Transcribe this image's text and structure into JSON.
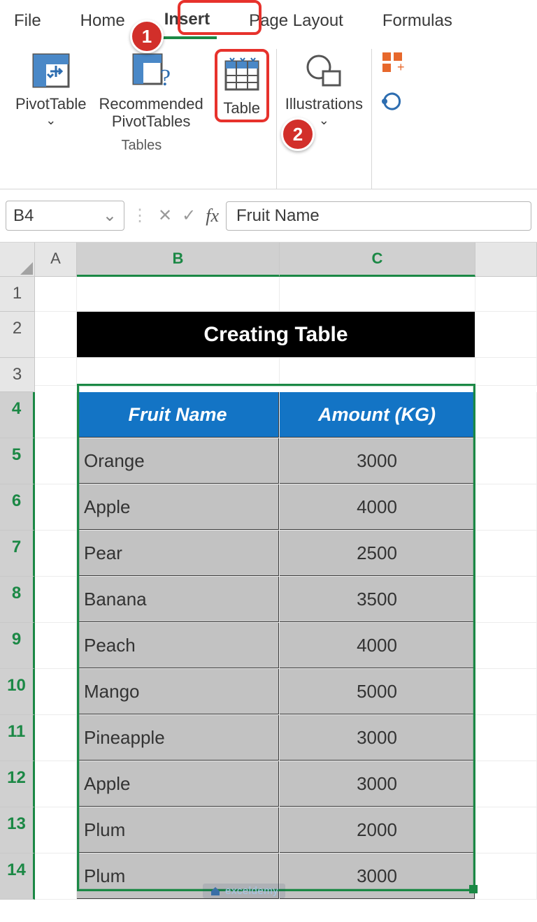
{
  "tabs": {
    "file": "File",
    "home": "Home",
    "insert": "Insert",
    "page_layout": "Page Layout",
    "formulas": "Formulas"
  },
  "ribbon": {
    "pivot_table": "PivotTable",
    "recommended_pivot": "Recommended\nPivotTables",
    "table": "Table",
    "illustrations": "Illustrations",
    "group_tables": "Tables"
  },
  "callouts": {
    "one": "1",
    "two": "2"
  },
  "namebox": {
    "ref": "B4"
  },
  "formula": {
    "value": "Fruit Name"
  },
  "columns": {
    "a": "A",
    "b": "B",
    "c": "C"
  },
  "rows": [
    "1",
    "2",
    "3",
    "4",
    "5",
    "6",
    "7",
    "8",
    "9",
    "10",
    "11",
    "12",
    "13",
    "14"
  ],
  "title": "Creating Table",
  "table_headers": {
    "fruit": "Fruit Name",
    "amount": "Amount (KG)"
  },
  "data": [
    {
      "fruit": "Orange",
      "amount": "3000"
    },
    {
      "fruit": "Apple",
      "amount": "4000"
    },
    {
      "fruit": "Pear",
      "amount": "2500"
    },
    {
      "fruit": "Banana",
      "amount": "3500"
    },
    {
      "fruit": "Peach",
      "amount": "4000"
    },
    {
      "fruit": "Mango",
      "amount": "5000"
    },
    {
      "fruit": "Pineapple",
      "amount": "3000"
    },
    {
      "fruit": "Apple",
      "amount": "3000"
    },
    {
      "fruit": "Plum",
      "amount": "2000"
    },
    {
      "fruit": "Plum",
      "amount": "3000"
    }
  ],
  "watermark": "exceldemy"
}
